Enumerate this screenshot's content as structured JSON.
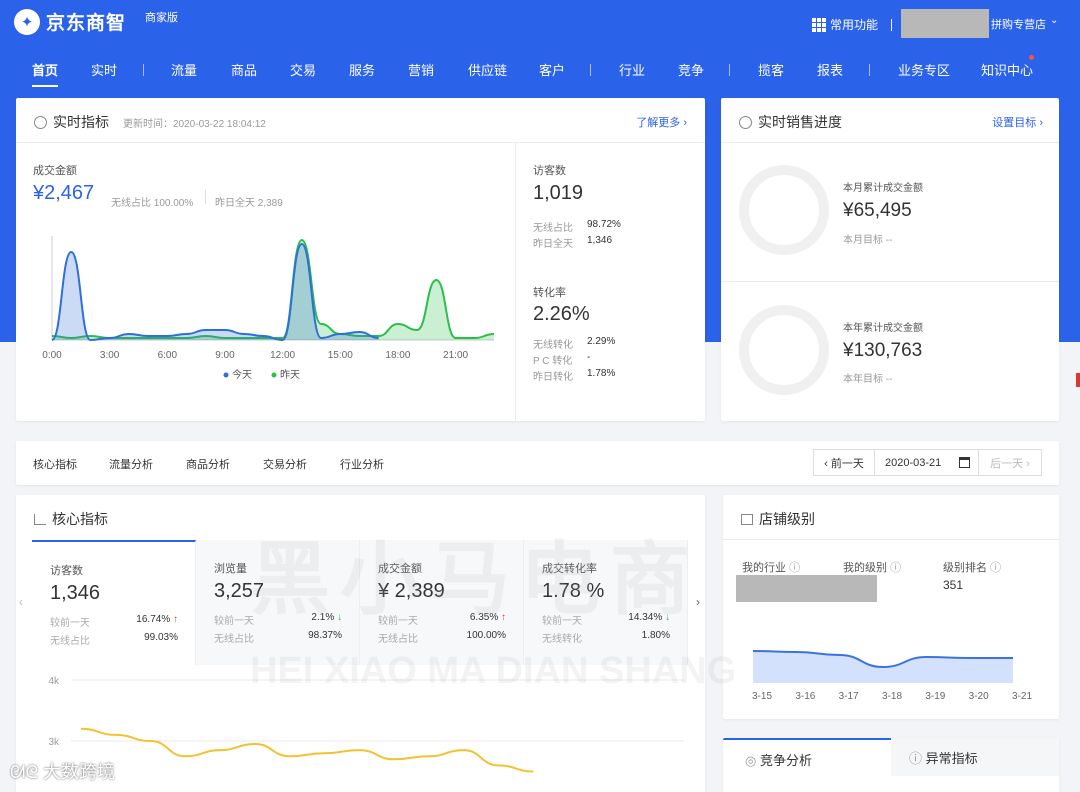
{
  "header": {
    "brand": "京东商智",
    "brand_sub": "商家版",
    "common_functions": "常用功能",
    "shop_suffix": "拼购专营店"
  },
  "nav": [
    {
      "label": "首页",
      "active": true
    },
    {
      "label": "实时"
    },
    {
      "label": "流量"
    },
    {
      "label": "商品"
    },
    {
      "label": "交易"
    },
    {
      "label": "服务"
    },
    {
      "label": "营销"
    },
    {
      "label": "供应链"
    },
    {
      "label": "客户"
    },
    {
      "label": "行业"
    },
    {
      "label": "竞争"
    },
    {
      "label": "揽客"
    },
    {
      "label": "报表"
    },
    {
      "label": "业务专区"
    },
    {
      "label": "知识中心"
    }
  ],
  "realtime": {
    "title": "实时指标",
    "updated": "更新时间：2020-03-22 18:04:12",
    "more": "了解更多",
    "gmv_label": "成交金额",
    "gmv": "¥2,467",
    "wireless_share": "无线占比  100.00%",
    "yesterday_total": "昨日全天  2,389",
    "visitors_label": "访客数",
    "visitors": "1,019",
    "visitors_wireless_label": "无线占比",
    "visitors_wireless": "98.72%",
    "visitors_yesterday_label": "昨日全天",
    "visitors_yesterday": "1,346",
    "cvr_label": "转化率",
    "cvr": "2.26%",
    "cvr_wireless_label": "无线转化",
    "cvr_wireless": "2.29%",
    "cvr_pc_label": "P C 转化",
    "cvr_pc": "-",
    "cvr_yesterday_label": "昨日转化",
    "cvr_yesterday": "1.78%",
    "legend_today": "今天",
    "legend_yesterday": "昨天"
  },
  "chart_data": {
    "type": "area",
    "x": [
      "0:00",
      "1:00",
      "2:00",
      "3:00",
      "4:00",
      "5:00",
      "6:00",
      "7:00",
      "8:00",
      "9:00",
      "10:00",
      "11:00",
      "12:00",
      "13:00",
      "14:00",
      "15:00",
      "16:00",
      "17:00",
      "18:00",
      "19:00",
      "20:00",
      "21:00",
      "22:00",
      "23:00"
    ],
    "tick_labels": [
      "0:00",
      "3:00",
      "6:00",
      "9:00",
      "12:00",
      "15:00",
      "18:00",
      "21:00"
    ],
    "series": [
      {
        "name": "今天",
        "color": "#2e6fd8",
        "values": [
          0,
          440,
          0,
          10,
          30,
          20,
          20,
          30,
          50,
          50,
          30,
          20,
          0,
          480,
          10,
          30,
          40,
          10,
          null,
          null,
          null,
          null,
          null,
          null
        ]
      },
      {
        "name": "昨天",
        "color": "#2bbf4a",
        "values": [
          20,
          10,
          20,
          10,
          10,
          10,
          10,
          10,
          20,
          10,
          10,
          10,
          10,
          500,
          80,
          30,
          20,
          20,
          80,
          50,
          300,
          10,
          10,
          30
        ]
      }
    ],
    "colors": {
      "today": "#2e6fd8",
      "yesterday": "#2bbf4a"
    }
  },
  "sales_progress": {
    "title": "实时销售进度",
    "set_target": "设置目标",
    "month_label": "本月累计成交金额",
    "month_value": "¥65,495",
    "month_target": "本月目标 --",
    "year_label": "本年累计成交金额",
    "year_value": "¥130,763",
    "year_target": "本年目标 --"
  },
  "tabs": [
    "核心指标",
    "流量分析",
    "商品分析",
    "交易分析",
    "行业分析"
  ],
  "date_picker": {
    "prev": "‹ 前一天",
    "date": "2020-03-21",
    "next": "后一天 ›"
  },
  "core": {
    "title": "核心指标",
    "metrics": [
      {
        "label": "访客数",
        "value": "1,346",
        "r1_label": "较前一天",
        "r1_value": "16.74%",
        "r1_dir": "up",
        "r2_label": "无线占比",
        "r2_value": "99.03%"
      },
      {
        "label": "浏览量",
        "value": "3,257",
        "r1_label": "较前一天",
        "r1_value": "2.1%",
        "r1_dir": "down",
        "r2_label": "无线占比",
        "r2_value": "98.37%"
      },
      {
        "label": "成交金额",
        "value": "¥ 2,389",
        "r1_label": "较前一天",
        "r1_value": "6.35%",
        "r1_dir": "up",
        "r2_label": "无线占比",
        "r2_value": "100.00%"
      },
      {
        "label": "成交转化率",
        "value": "1.78 %",
        "r1_label": "较前一天",
        "r1_value": "14.34%",
        "r1_dir": "down",
        "r2_label": "无线转化",
        "r2_value": "1.80%"
      }
    ],
    "y_ticks": [
      "4k",
      "3k"
    ],
    "trend_values": [
      3200,
      3100,
      3000,
      2750,
      2850,
      2950,
      2750,
      2800,
      2850,
      2700,
      2750,
      2850,
      2600,
      2500
    ]
  },
  "shop_level": {
    "title": "店铺级别",
    "industry_label": "我的行业",
    "level_label": "我的级别",
    "rank_label": "级别排名",
    "rank_value": "351",
    "x_ticks": [
      "3-15",
      "3-16",
      "3-17",
      "3-18",
      "3-19",
      "3-20",
      "3-21"
    ]
  },
  "bottom_tabs": {
    "competition": "竞争分析",
    "anomaly": "异常指标"
  },
  "watermark": {
    "cn": "黑小马电商",
    "en": "HEI XIAO MA DIAN SHANG",
    "corner": "大数跨境"
  }
}
